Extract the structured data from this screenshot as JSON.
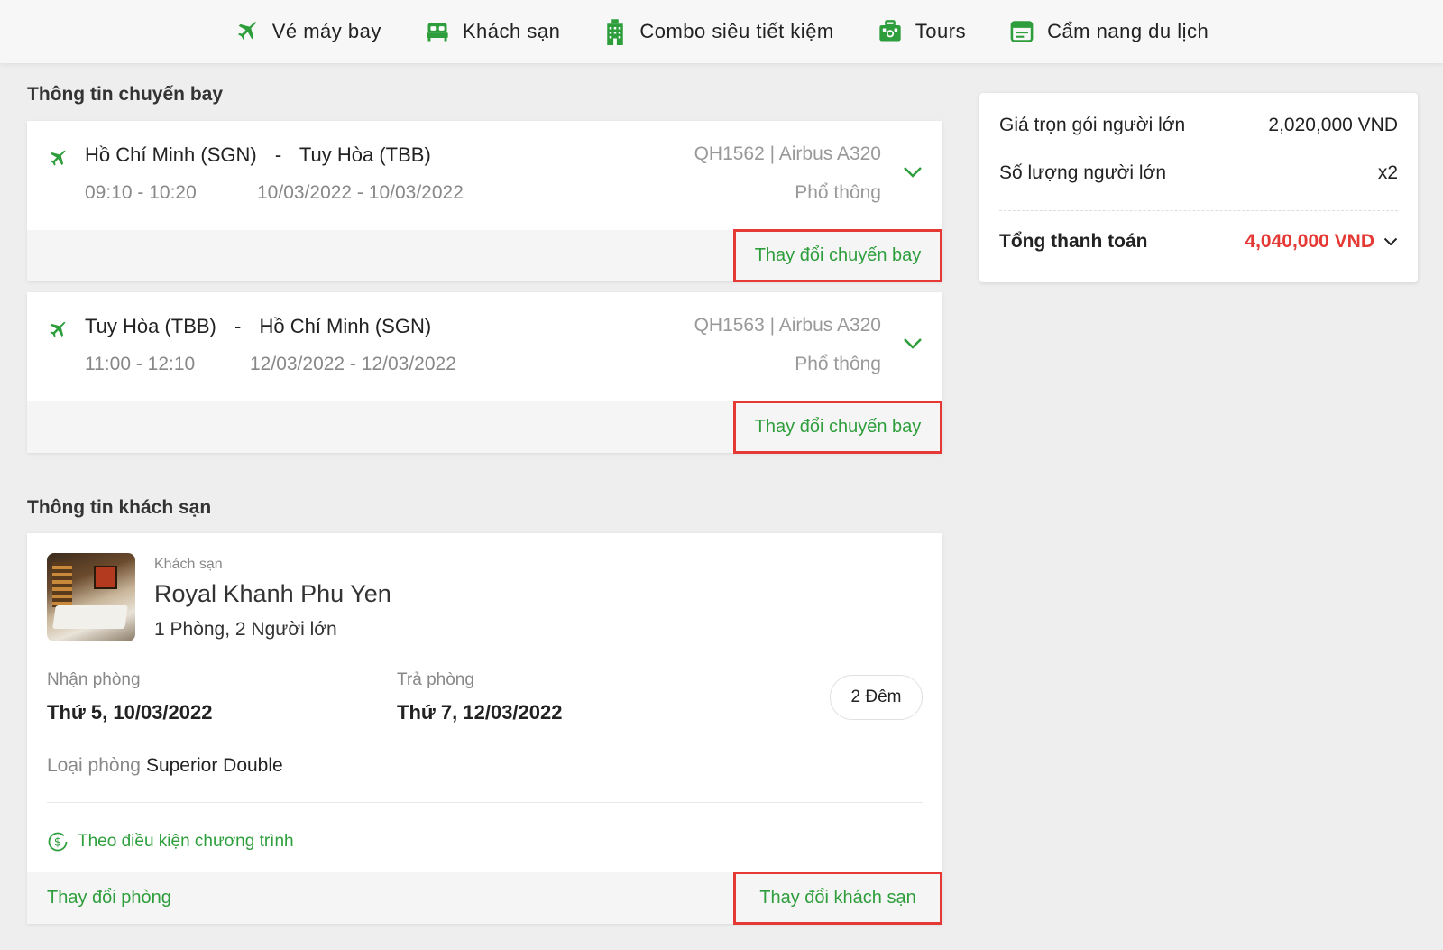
{
  "nav": {
    "items": [
      {
        "label": "Vé máy bay",
        "icon": "plane-icon"
      },
      {
        "label": "Khách sạn",
        "icon": "bed-icon"
      },
      {
        "label": "Combo siêu tiết kiệm",
        "icon": "building-icon"
      },
      {
        "label": "Tours",
        "icon": "luggage-icon"
      },
      {
        "label": "Cẩm nang du lịch",
        "icon": "guidebook-icon"
      }
    ]
  },
  "flights": {
    "section_title": "Thông tin chuyến bay",
    "items": [
      {
        "origin": "Hồ Chí Minh (SGN)",
        "separator": "-",
        "destination": "Tuy Hòa (TBB)",
        "time": "09:10 - 10:20",
        "date": "10/03/2022 - 10/03/2022",
        "flight_info": "QH1562 | Airbus A320",
        "cabin": "Phổ thông",
        "change_label": "Thay đổi chuyến bay"
      },
      {
        "origin": "Tuy Hòa (TBB)",
        "separator": "-",
        "destination": "Hồ Chí Minh (SGN)",
        "time": "11:00 - 12:10",
        "date": "12/03/2022 - 12/03/2022",
        "flight_info": "QH1563 | Airbus A320",
        "cabin": "Phổ thông",
        "change_label": "Thay đổi chuyến bay"
      }
    ]
  },
  "hotel": {
    "section_title": "Thông tin khách sạn",
    "caption": "Khách sạn",
    "name": "Royal Khanh Phu Yen",
    "occupancy": "1 Phòng, 2 Người lớn",
    "checkin_label": "Nhận phòng",
    "checkin_value": "Thứ 5, 10/03/2022",
    "checkout_label": "Trả phòng",
    "checkout_value": "Thứ 7, 12/03/2022",
    "nights": "2 Đêm",
    "room_type_label": "Loại phòng",
    "room_type_value": "Superior Double",
    "promo_label": "Theo điều kiện chương trình",
    "change_room_label": "Thay đổi phòng",
    "change_hotel_label": "Thay đổi khách sạn"
  },
  "summary": {
    "adult_price_label": "Giá trọn gói người lớn",
    "adult_price_value": "2,020,000 VND",
    "adult_count_label": "Số lượng người lớn",
    "adult_count_value": "x2",
    "total_label": "Tổng thanh toán",
    "total_value": "4,040,000 VND"
  },
  "colors": {
    "accent_green": "#2e9e3c",
    "total_red": "#e53935",
    "highlight_border": "#e53935"
  }
}
